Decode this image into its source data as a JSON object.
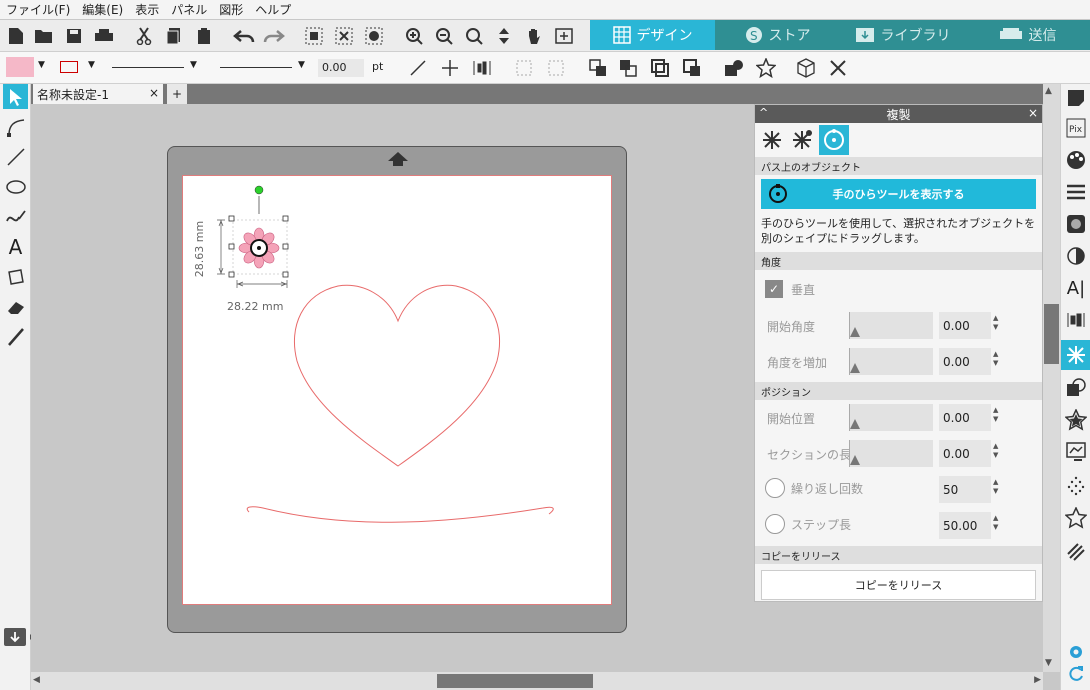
{
  "menu": [
    "ファイル(F)",
    "編集(E)",
    "表示",
    "パネル",
    "図形",
    "ヘルプ"
  ],
  "tabs": [
    {
      "label": "デザイン",
      "icon": "grid-icon"
    },
    {
      "label": "ストア",
      "icon": "store-icon"
    },
    {
      "label": "ライブラリ",
      "icon": "library-icon"
    },
    {
      "label": "送信",
      "icon": "send-icon"
    }
  ],
  "toolbar2": {
    "line_width": "0.00",
    "unit": "pt",
    "fill_color": "#f5b8c8"
  },
  "document": {
    "tab_title": "名称未設定-1",
    "close": "×",
    "add": "+"
  },
  "canvas": {
    "height_label": "28.63 mm",
    "width_label": "28.22 mm"
  },
  "panel": {
    "title": "複製",
    "section_path": "パス上のオブジェクト",
    "show_hand_button": "手のひらツールを表示する",
    "description": "手のひらツールを使用して、選択されたオブジェクトを別のシェイプにドラッグします。",
    "section_angle": "角度",
    "vertical_label": "垂直",
    "start_angle_label": "開始角度",
    "start_angle_value": "0.00",
    "add_angle_label": "角度を増加",
    "add_angle_value": "0.00",
    "section_position": "ポジション",
    "start_pos_label": "開始位置",
    "start_pos_value": "0.00",
    "section_length_label": "セクションの長さ",
    "section_length_value": "0.00",
    "repeat_label": "繰り返し回数",
    "repeat_value": "50",
    "step_label": "ステップ長",
    "step_value": "50.00",
    "section_release": "コピーをリリース",
    "release_button": "コピーをリリース"
  }
}
